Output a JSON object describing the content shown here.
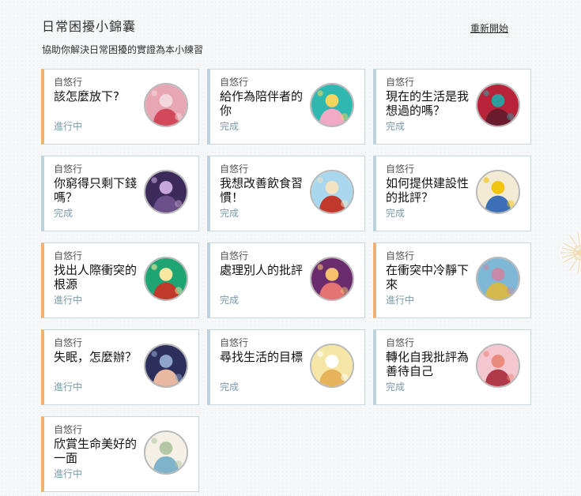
{
  "header": {
    "title": "日常困擾小錦囊",
    "subtitle": "協助你解決日常困擾的實證為本小練習",
    "restart_label": "重新開始"
  },
  "cards": [
    {
      "author": "自悠行",
      "title": "該怎麼放下?",
      "status": "進行中",
      "state": "progress",
      "icon": "letting-go-illustration",
      "colors": [
        "#e8a6b4",
        "#d1495b",
        "#f2d7dd"
      ]
    },
    {
      "author": "自悠行",
      "title": "給作為陪伴者的你",
      "status": "完成",
      "state": "done",
      "icon": "caregivers-illustration",
      "colors": [
        "#2eb8b0",
        "#f2a9c4",
        "#f4d35e"
      ]
    },
    {
      "author": "自悠行",
      "title": "現在的生活是我想過的嗎？",
      "status": "完成",
      "state": "done",
      "icon": "life-reflection-illustration",
      "colors": [
        "#b8233a",
        "#6a1b2e",
        "#2f9e9e"
      ]
    },
    {
      "author": "自悠行",
      "title": "你窮得只剩下錢嗎？",
      "status": "完成",
      "state": "done",
      "icon": "money-illustration",
      "colors": [
        "#3c2a5a",
        "#6b4f8a",
        "#c7a6d9"
      ]
    },
    {
      "author": "自悠行",
      "title": "我想改善飲食習慣！",
      "status": "完成",
      "state": "done",
      "icon": "eating-habits-illustration",
      "colors": [
        "#a9d8ee",
        "#c0392b",
        "#f4e1c1"
      ]
    },
    {
      "author": "自悠行",
      "title": "如何提供建設性的批評？",
      "status": "完成",
      "state": "done",
      "icon": "feedback-illustration",
      "colors": [
        "#f3ead3",
        "#3d6fb6",
        "#f1c40f"
      ]
    },
    {
      "author": "自悠行",
      "title": "找出人際衝突的根源",
      "status": "進行中",
      "state": "progress",
      "icon": "conflict-root-illustration",
      "colors": [
        "#1fa574",
        "#c0392b",
        "#f9e79f"
      ]
    },
    {
      "author": "自悠行",
      "title": "處理別人的批評",
      "status": "完成",
      "state": "done",
      "icon": "criticism-illustration",
      "colors": [
        "#6b2c6e",
        "#e57373",
        "#f5c16c"
      ]
    },
    {
      "author": "自悠行",
      "title": "在衝突中冷靜下來",
      "status": "進行中",
      "state": "progress",
      "icon": "calm-down-illustration",
      "colors": [
        "#7fb8d6",
        "#d4b84c",
        "#c78aa6"
      ]
    },
    {
      "author": "自悠行",
      "title": "失眠，怎麼辦？",
      "status": "進行中",
      "state": "progress",
      "icon": "insomnia-illustration",
      "colors": [
        "#2c2f5b",
        "#e8b9a0",
        "#8fa4c9"
      ]
    },
    {
      "author": "自悠行",
      "title": "尋找生活的目標",
      "status": "完成",
      "state": "done",
      "icon": "life-goal-illustration",
      "colors": [
        "#f5e6a8",
        "#e6b35a",
        "#ffffff"
      ]
    },
    {
      "author": "自悠行",
      "title": "轉化自我批評為善待自己",
      "status": "完成",
      "state": "done",
      "icon": "self-compassion-illustration",
      "colors": [
        "#f4c6cf",
        "#b03a48",
        "#e98b7a"
      ]
    },
    {
      "author": "自悠行",
      "title": "欣賞生命美好的一面",
      "status": "進行中",
      "state": "progress",
      "icon": "appreciation-illustration",
      "colors": [
        "#f4f0e6",
        "#7fb3c9",
        "#b3c7a5"
      ]
    }
  ]
}
